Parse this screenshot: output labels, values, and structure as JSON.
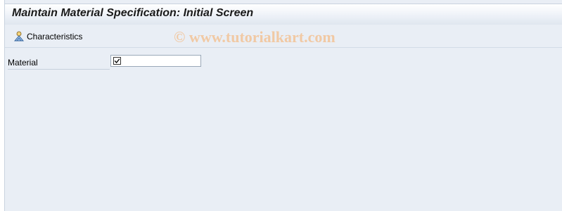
{
  "header": {
    "title": "Maintain Material Specification: Initial Screen"
  },
  "toolbar": {
    "characteristics_label": "Characteristics",
    "characteristics_icon": "characteristics-icon"
  },
  "watermark": {
    "text": "© www.tutorialkart.com"
  },
  "form": {
    "material": {
      "label": "Material",
      "value": "",
      "required_icon": "required-checkbox-icon"
    }
  },
  "colors": {
    "background": "#e9eef5",
    "title_text": "#1a1a1a",
    "watermark": "#f1c9a4"
  }
}
